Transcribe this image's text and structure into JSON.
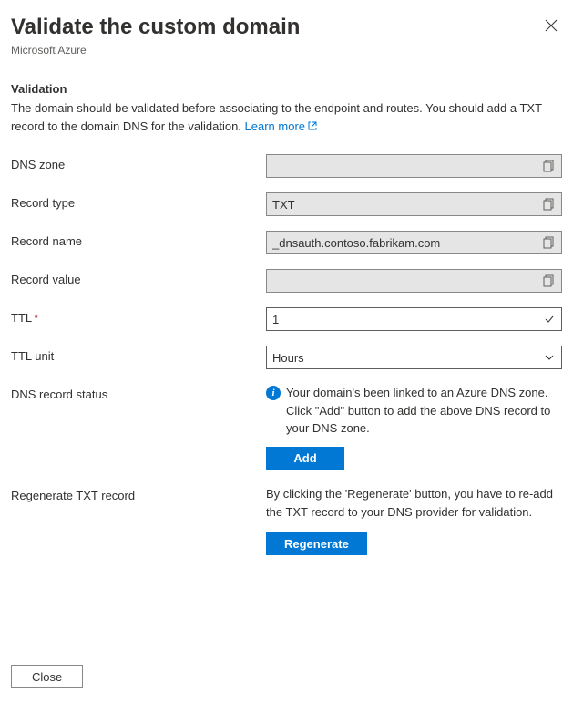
{
  "header": {
    "title": "Validate the custom domain",
    "subtitle": "Microsoft Azure"
  },
  "section": {
    "heading": "Validation",
    "description": "The domain should be validated before associating to the endpoint and routes. You should add a TXT record to the domain DNS for the validation. ",
    "learn_more": "Learn more"
  },
  "fields": {
    "dns_zone": {
      "label": "DNS zone",
      "value": ""
    },
    "record_type": {
      "label": "Record type",
      "value": "TXT"
    },
    "record_name": {
      "label": "Record name",
      "value": "_dnsauth.contoso.fabrikam.com"
    },
    "record_value": {
      "label": "Record value",
      "value": ""
    },
    "ttl": {
      "label": "TTL",
      "value": "1",
      "required": "*"
    },
    "ttl_unit": {
      "label": "TTL unit",
      "value": "Hours"
    },
    "dns_record_status": {
      "label": "DNS record status",
      "message": "Your domain's been linked to an Azure DNS zone. Click \"Add\" button to add the above DNS record to your DNS zone.",
      "button": "Add"
    },
    "regenerate": {
      "label": "Regenerate TXT record",
      "message": "By clicking the 'Regenerate' button, you have to re-add the TXT record to your DNS provider for validation.",
      "button": "Regenerate"
    }
  },
  "footer": {
    "close": "Close"
  }
}
